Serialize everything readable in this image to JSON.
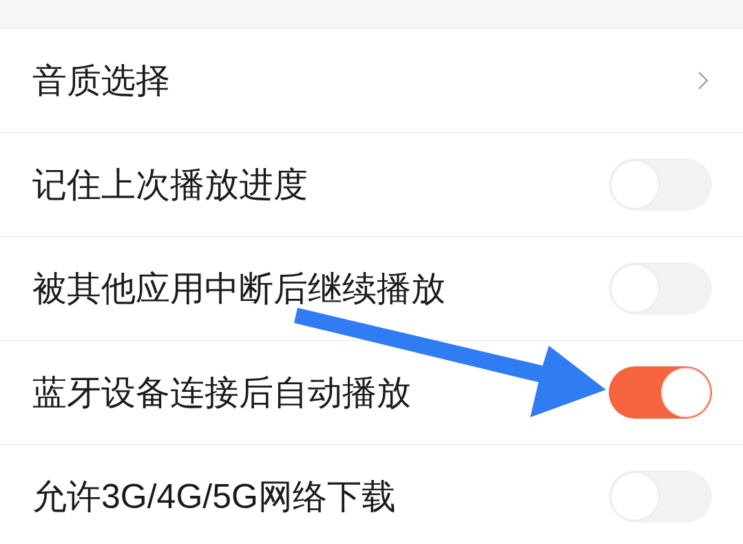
{
  "settings": [
    {
      "kind": "link",
      "label": "音质选择"
    },
    {
      "kind": "toggle",
      "label": "记住上次播放进度",
      "on": false
    },
    {
      "kind": "toggle",
      "label": "被其他应用中断后继续播放",
      "on": false
    },
    {
      "kind": "toggle",
      "label": "蓝牙设备连接后自动播放",
      "on": true
    },
    {
      "kind": "toggle",
      "label": "允许3G/4G/5G网络下载",
      "on": false
    }
  ]
}
